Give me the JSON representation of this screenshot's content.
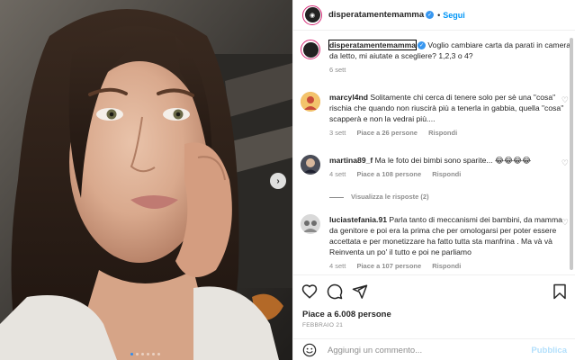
{
  "header": {
    "username": "disperatamentemamma",
    "separator": "•",
    "follow_label": "Segui"
  },
  "caption": {
    "username": "disperatamentemamma",
    "text": "Voglio cambiare carta da parati in camera da letto, mi aiutate a scegliere? 1,2,3 o 4?",
    "time": "6 sett"
  },
  "comments": [
    {
      "username": "marcyl4nd",
      "text": "Solitamente chi cerca di tenere solo per sè una \"cosa\" rischia che quando non riuscirà più a tenerla in gabbia, quella \"cosa\" scapperà e non la vedrai più....",
      "time": "3 sett",
      "likes": "Piace a 26 persone",
      "reply": "Rispondi"
    },
    {
      "username": "martina89_f",
      "text": "Ma le foto dei bimbi sono sparite... 😂😂😂😂",
      "time": "4 sett",
      "likes": "Piace a 108 persone",
      "reply": "Rispondi"
    },
    {
      "username": "luciastefania.91",
      "text": "Parla tanto di meccanismi dei bambini, da mamma da genitore e poi era la prima che per omologarsi per poter essere accettata e per monetizzare ha fatto tutta sta manfrina . Ma và và Reinventa un po' il tutto e poi ne parliamo",
      "time": "4 sett",
      "likes": "Piace a 107 persone",
      "reply": "Rispondi"
    }
  ],
  "view_replies": "Visualizza le risposte (2)",
  "post": {
    "likes": "Piace a 6.008 persone",
    "date": "FEBBRAIO 21"
  },
  "add_comment": {
    "placeholder": "Aggiungi un commento...",
    "publish": "Pubblica"
  },
  "icons": {
    "like": "heart-icon",
    "comment": "comment-icon",
    "share": "share-icon",
    "save": "bookmark-icon",
    "emoji": "emoji-icon",
    "verified": "verified-badge-icon",
    "next": "chevron-right-icon"
  },
  "carousel": {
    "slides": 6,
    "active": 1
  },
  "colors": {
    "link": "#0095f6",
    "verified": "#3897f0",
    "muted": "#8e8e8e",
    "text": "#262626"
  }
}
